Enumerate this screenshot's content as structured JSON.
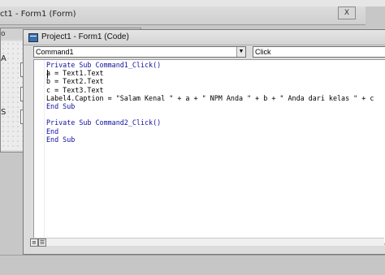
{
  "background_window": {
    "title": "ct1 - Form1 (Form)",
    "close_label": "X",
    "form": {
      "title": "o",
      "labels": [
        "A",
        "S"
      ]
    }
  },
  "code_window": {
    "title": "Project1 - Form1 (Code)",
    "object_combo": "Command1",
    "procedure_combo": "Click",
    "code_lines": [
      "Private Sub Command1_Click()",
      "a = Text1.Text",
      "b = Text2.Text",
      "c = Text3.Text",
      "Label4.Caption = \"Salam Kenal \" + a + \" NPM Anda \" + b + \" Anda dari kelas \" + c",
      "End Sub",
      "",
      "Private Sub Command2_Click()",
      "End",
      "End Sub"
    ]
  },
  "colors": {
    "keyword": "#1010a0",
    "background": "#ababab"
  },
  "icons": [
    "app-icon",
    "dropdown-arrow-icon",
    "procedure-view-icon",
    "full-module-view-icon"
  ]
}
